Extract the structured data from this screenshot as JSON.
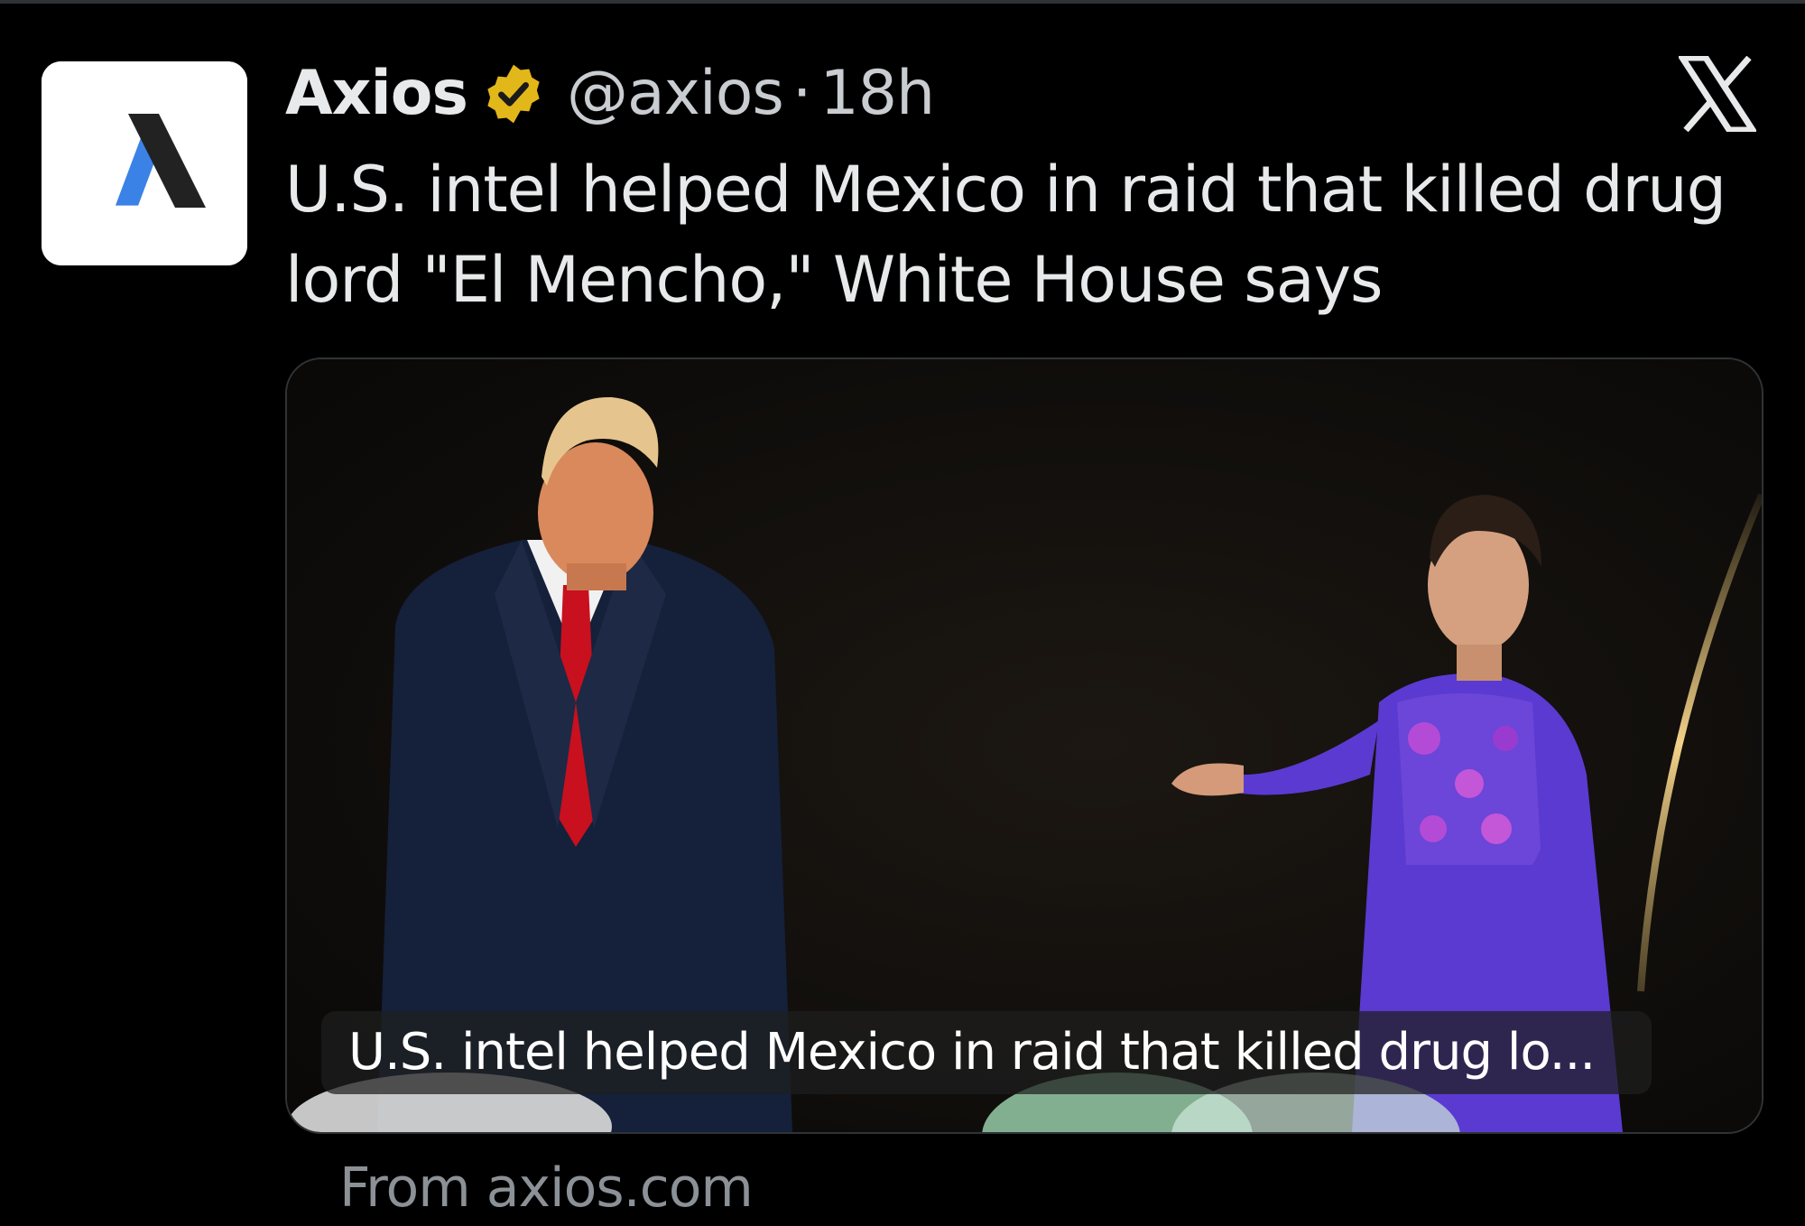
{
  "tweet": {
    "author": {
      "display_name": "Axios",
      "handle": "@axios",
      "verified": true,
      "verified_color": "#e2b719",
      "avatar_icon": "axios-logo-icon"
    },
    "separator": "·",
    "timestamp": "18h",
    "platform_icon": "x-logo-icon",
    "text": "U.S. intel helped Mexico in raid that killed drug lord \"El Mencho,\" White House says",
    "card": {
      "image_alt": "Photo of a man in a dark suit with a red tie standing on stage next to a woman in a purple embroidered dress gesturing while speaking",
      "title_overlay": "U.S. intel helped Mexico in raid that killed drug lo...",
      "source": "From axios.com"
    }
  },
  "colors": {
    "background": "#000000",
    "text_primary": "#e7e9ea",
    "text_secondary": "#c9cdd1",
    "source_text": "#8b9196",
    "border": "#2f3336",
    "axios_blue": "#3b82e6",
    "suit_navy": "#15203a",
    "tie_red": "#c8101e",
    "dress_purple": "#5b3ad1"
  }
}
